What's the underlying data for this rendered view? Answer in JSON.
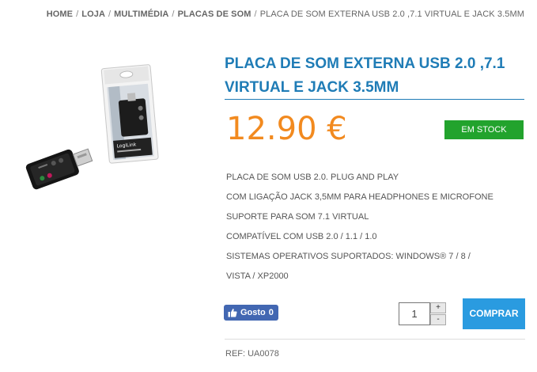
{
  "breadcrumb": {
    "items": [
      "HOME",
      "LOJA",
      "MULTIMÉDIA",
      "PLACAS DE SOM"
    ],
    "separator": "/",
    "current": "PLACA DE SOM EXTERNA USB 2.0 ,7.1 VIRTUAL E JACK 3.5MM"
  },
  "product": {
    "title": "PLACA DE SOM EXTERNA USB 2.0 ,7.1 VIRTUAL E JACK 3.5MM",
    "price": "12.90 €",
    "stock_status": "EM STOCK",
    "features": [
      "PLACA DE SOM USB 2.0. PLUG AND PLAY",
      "COM LIGAÇÃO JACK 3,5MM PARA HEADPHONES E MICROFONE",
      "SUPORTE PARA SOM 7.1 VIRTUAL",
      "COMPATÍVEL COM USB 2.0 / 1.1 / 1.0",
      "SISTEMAS OPERATIVOS SUPORTADOS: WINDOWS® 7 / 8 / VISTA / XP2000"
    ],
    "reference": "REF: UA0078",
    "image_package_label": "LogiLink"
  },
  "social": {
    "like_label": "Gosto",
    "like_count": "0"
  },
  "purchase": {
    "quantity": "1",
    "plus": "+",
    "minus": "-",
    "buy_label": "COMPRAR"
  },
  "colors": {
    "accent": "#1f7cb6",
    "price": "#f28a1f",
    "stock": "#22a32d",
    "buy": "#2a9be0",
    "facebook": "#4267b2"
  }
}
